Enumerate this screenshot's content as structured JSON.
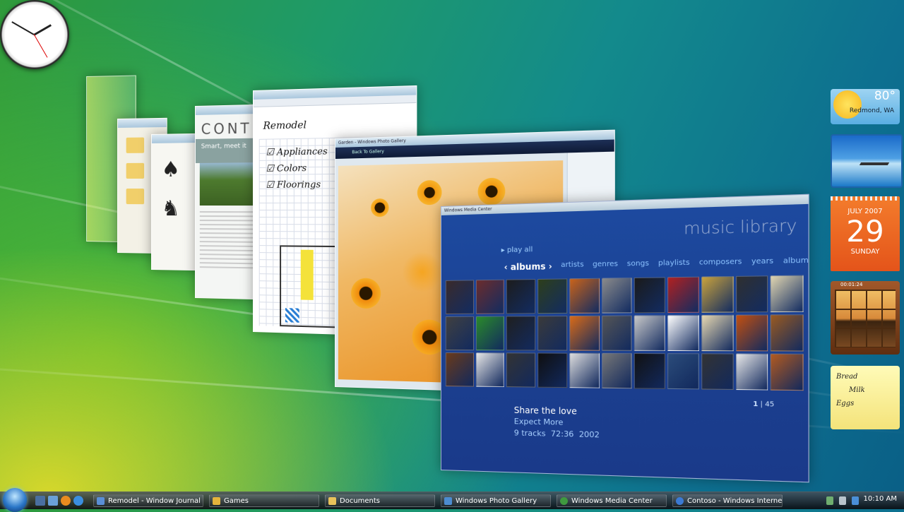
{
  "desktop": {
    "wallpaper": "windows-vista-aurora"
  },
  "windows": {
    "media_center": {
      "caption": "Windows Media Center",
      "title": "music library",
      "play_all": "play all",
      "tabs": [
        {
          "label": "albums"
        },
        {
          "label": "artists"
        },
        {
          "label": "genres"
        },
        {
          "label": "songs"
        },
        {
          "label": "playlists"
        },
        {
          "label": "composers"
        },
        {
          "label": "years"
        },
        {
          "label": "album arti"
        }
      ],
      "album": {
        "title": "Share the love",
        "artist": "Expect More",
        "tracks": "9 tracks",
        "length": "72:36",
        "year": "2002"
      },
      "page": {
        "current": "1",
        "total": "45"
      }
    },
    "photo_gallery": {
      "caption": "Garden - Windows Photo Gallery",
      "back": "Back To Gallery"
    },
    "journal": {
      "heading": "Remodel",
      "checklist": [
        "Appliances",
        "Colors",
        "Floorings"
      ]
    },
    "contoso": {
      "logo": "CONT",
      "tagline": "Smart, meet it"
    }
  },
  "gadgets": {
    "weather": {
      "temp": "80°",
      "location": "Redmond, WA"
    },
    "calendar": {
      "month": "JULY 2007",
      "day": "29",
      "weekday": "SUNDAY"
    },
    "puzzle": {
      "timer": "00:01:24"
    },
    "notes": [
      "Bread",
      "Milk",
      "Eggs"
    ]
  },
  "taskbar": {
    "items": [
      {
        "label": "Remodel - Window Journal",
        "color": "#5a8fd6"
      },
      {
        "label": "Games",
        "color": "#e4b33c"
      },
      {
        "label": "Documents",
        "color": "#e8c25a"
      },
      {
        "label": "Windows Photo Gallery",
        "color": "#4c8cd0"
      },
      {
        "label": "Windows Media Center",
        "color": "#3f9a3f"
      },
      {
        "label": "Contoso - Windows Internet...",
        "color": "#3b7ad4"
      }
    ],
    "clock": "10:10 AM"
  }
}
